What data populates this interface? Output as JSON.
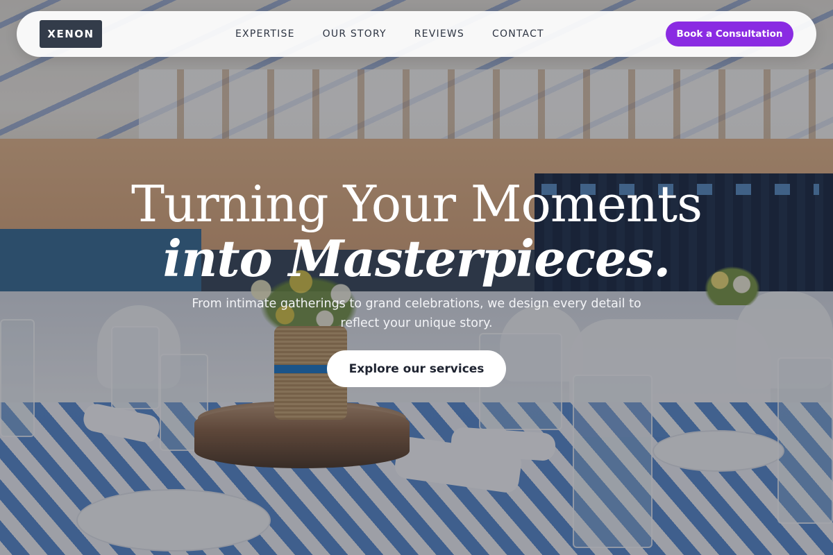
{
  "brand": {
    "logo_text": "XENON"
  },
  "nav": {
    "links": [
      {
        "label": "EXPERTISE"
      },
      {
        "label": "OUR STORY"
      },
      {
        "label": "REVIEWS"
      },
      {
        "label": "CONTACT"
      }
    ],
    "cta_label": "Book a Consultation"
  },
  "hero": {
    "title_line1": "Turning Your Moments",
    "title_line2": "into Masterpieces.",
    "subtitle": "From intimate gatherings to grand celebrations, we design every detail to reflect your unique story.",
    "button_label": "Explore our services"
  },
  "colors": {
    "accent": "#8a2be2",
    "logo_bg": "#333c4a",
    "nav_bg": "#ffffff",
    "hero_text": "#ffffff"
  }
}
